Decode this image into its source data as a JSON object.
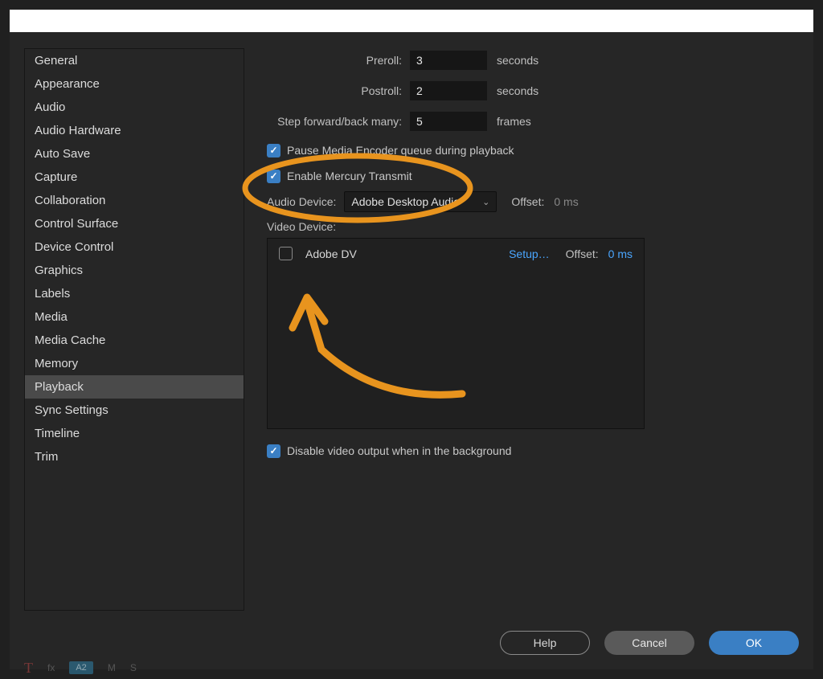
{
  "sidebar": {
    "items": [
      {
        "label": "General"
      },
      {
        "label": "Appearance"
      },
      {
        "label": "Audio"
      },
      {
        "label": "Audio Hardware"
      },
      {
        "label": "Auto Save"
      },
      {
        "label": "Capture"
      },
      {
        "label": "Collaboration"
      },
      {
        "label": "Control Surface"
      },
      {
        "label": "Device Control"
      },
      {
        "label": "Graphics"
      },
      {
        "label": "Labels"
      },
      {
        "label": "Media"
      },
      {
        "label": "Media Cache"
      },
      {
        "label": "Memory"
      },
      {
        "label": "Playback"
      },
      {
        "label": "Sync Settings"
      },
      {
        "label": "Timeline"
      },
      {
        "label": "Trim"
      }
    ],
    "selectedIndex": "14"
  },
  "playback": {
    "preroll_label": "Preroll:",
    "preroll_value": "3",
    "postroll_label": "Postroll:",
    "postroll_value": "2",
    "seconds_unit": "seconds",
    "step_label": "Step forward/back many:",
    "step_value": "5",
    "frames_unit": "frames",
    "pause_encoder_label": "Pause Media Encoder queue during playback",
    "mercury_label": "Enable Mercury Transmit",
    "audio_device_label": "Audio Device:",
    "audio_device_value": "Adobe Desktop Audio",
    "offset_label": "Offset:",
    "audio_offset_value": "0 ms",
    "video_device_label": "Video Device:",
    "video_item_name": "Adobe DV",
    "video_setup": "Setup…",
    "video_offset_label": "Offset:",
    "video_offset_value": "0 ms",
    "disable_bg_label": "Disable video output when in the background"
  },
  "buttons": {
    "help": "Help",
    "cancel": "Cancel",
    "ok": "OK"
  },
  "timeline_hint": {
    "t": "T",
    "fx": "fx",
    "a2": "A2",
    "m": "M",
    "s": "S"
  },
  "annotation": {
    "stroke": "#e8941e"
  }
}
